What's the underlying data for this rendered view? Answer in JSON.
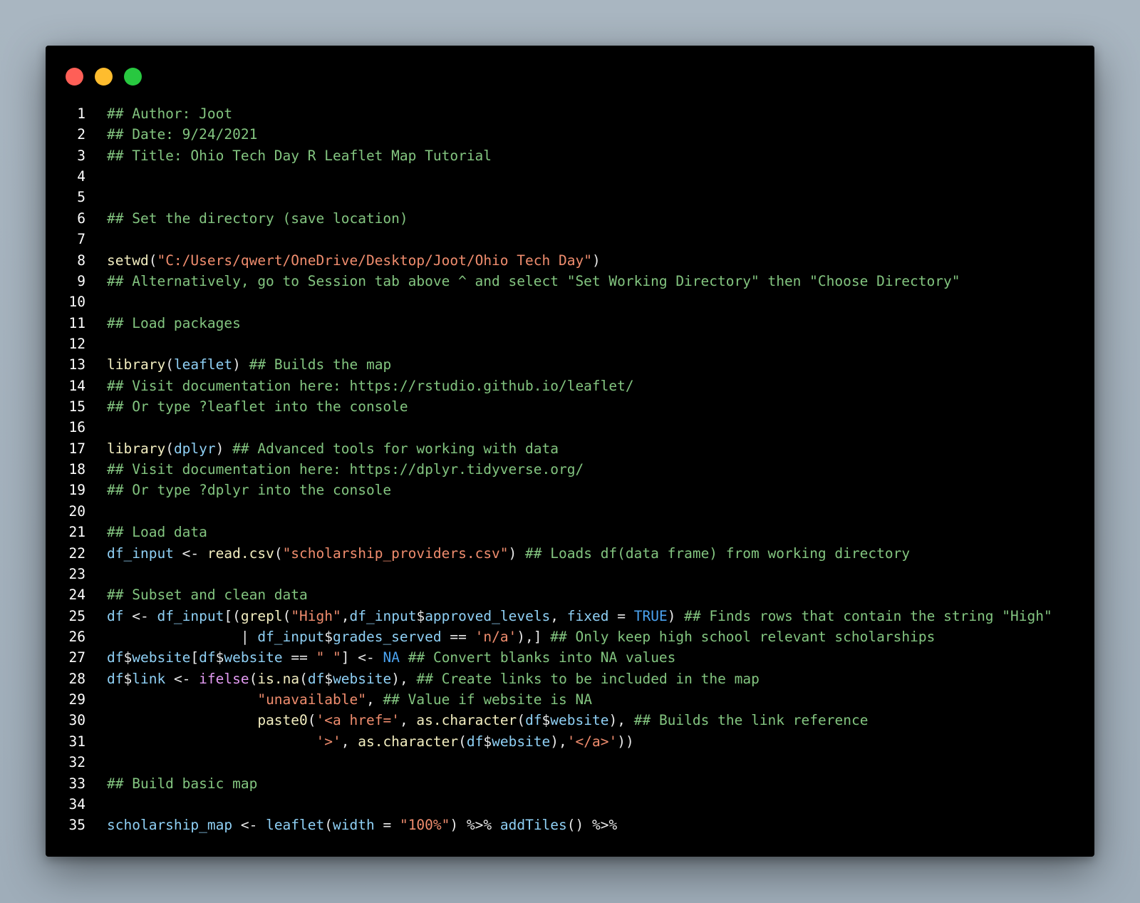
{
  "window": {
    "controls": [
      {
        "name": "close",
        "color": "#fe5f57"
      },
      {
        "name": "minimize",
        "color": "#febc2e"
      },
      {
        "name": "maximize",
        "color": "#28c840"
      }
    ]
  },
  "colors": {
    "comment": "#8fd68b",
    "string": "#f08d6e",
    "identifier": "#8fd0f5",
    "function": "#f3eec0",
    "constant": "#4ba3f0",
    "ifelse": "#e39bf2",
    "plain": "#e8e8e8"
  },
  "lines": [
    {
      "n": "1",
      "tokens": [
        [
          "cm",
          "## Author: Joot"
        ]
      ]
    },
    {
      "n": "2",
      "tokens": [
        [
          "cm",
          "## Date: 9/24/2021"
        ]
      ]
    },
    {
      "n": "3",
      "tokens": [
        [
          "cm",
          "## Title: Ohio Tech Day R Leaflet Map Tutorial"
        ]
      ]
    },
    {
      "n": "4",
      "tokens": []
    },
    {
      "n": "5",
      "tokens": []
    },
    {
      "n": "6",
      "tokens": [
        [
          "cm",
          "## Set the directory (save location)"
        ]
      ]
    },
    {
      "n": "7",
      "tokens": []
    },
    {
      "n": "8",
      "tokens": [
        [
          "fn",
          "setwd"
        ],
        [
          "plain",
          "("
        ],
        [
          "str",
          "\"C:/Users/qwert/OneDrive/Desktop/Joot/Ohio Tech Day\""
        ],
        [
          "plain",
          ")"
        ]
      ]
    },
    {
      "n": "9",
      "tokens": [
        [
          "cm",
          "## Alternatively, go to Session tab above ^ and select \"Set Working Directory\" then \"Choose Directory\""
        ]
      ]
    },
    {
      "n": "10",
      "tokens": []
    },
    {
      "n": "11",
      "tokens": [
        [
          "cm",
          "## Load packages"
        ]
      ]
    },
    {
      "n": "12",
      "tokens": []
    },
    {
      "n": "13",
      "tokens": [
        [
          "fn",
          "library"
        ],
        [
          "plain",
          "("
        ],
        [
          "id",
          "leaflet"
        ],
        [
          "plain",
          ") "
        ],
        [
          "cm",
          "## Builds the map"
        ]
      ]
    },
    {
      "n": "14",
      "tokens": [
        [
          "cm",
          "## Visit documentation here: https://rstudio.github.io/leaflet/"
        ]
      ]
    },
    {
      "n": "15",
      "tokens": [
        [
          "cm",
          "## Or type ?leaflet into the console"
        ]
      ]
    },
    {
      "n": "16",
      "tokens": []
    },
    {
      "n": "17",
      "tokens": [
        [
          "fn",
          "library"
        ],
        [
          "plain",
          "("
        ],
        [
          "id",
          "dplyr"
        ],
        [
          "plain",
          ") "
        ],
        [
          "cm",
          "## Advanced tools for working with data"
        ]
      ]
    },
    {
      "n": "18",
      "tokens": [
        [
          "cm",
          "## Visit documentation here: https://dplyr.tidyverse.org/"
        ]
      ]
    },
    {
      "n": "19",
      "tokens": [
        [
          "cm",
          "## Or type ?dplyr into the console"
        ]
      ]
    },
    {
      "n": "20",
      "tokens": []
    },
    {
      "n": "21",
      "tokens": [
        [
          "cm",
          "## Load data"
        ]
      ]
    },
    {
      "n": "22",
      "tokens": [
        [
          "id",
          "df_input"
        ],
        [
          "plain",
          " <- "
        ],
        [
          "fn",
          "read.csv"
        ],
        [
          "plain",
          "("
        ],
        [
          "str",
          "\"scholarship_providers.csv\""
        ],
        [
          "plain",
          ") "
        ],
        [
          "cm",
          "## Loads df(data frame) from working directory"
        ]
      ]
    },
    {
      "n": "23",
      "tokens": []
    },
    {
      "n": "24",
      "tokens": [
        [
          "cm",
          "## Subset and clean data"
        ]
      ]
    },
    {
      "n": "25",
      "tokens": [
        [
          "id",
          "df"
        ],
        [
          "plain",
          " <- "
        ],
        [
          "id",
          "df_input"
        ],
        [
          "plain",
          "[("
        ],
        [
          "fn",
          "grepl"
        ],
        [
          "plain",
          "("
        ],
        [
          "str",
          "\"High\""
        ],
        [
          "plain",
          ","
        ],
        [
          "id",
          "df_input"
        ],
        [
          "plain",
          "$"
        ],
        [
          "id",
          "approved_levels"
        ],
        [
          "plain",
          ", "
        ],
        [
          "id",
          "fixed"
        ],
        [
          "plain",
          " = "
        ],
        [
          "kw",
          "TRUE"
        ],
        [
          "plain",
          ") "
        ],
        [
          "cm",
          "## Finds rows that contain the string \"High\""
        ]
      ]
    },
    {
      "n": "26",
      "tokens": [
        [
          "plain",
          "                | "
        ],
        [
          "id",
          "df_input"
        ],
        [
          "plain",
          "$"
        ],
        [
          "id",
          "grades_served"
        ],
        [
          "plain",
          " == "
        ],
        [
          "str",
          "'n/a'"
        ],
        [
          "plain",
          "),] "
        ],
        [
          "cm",
          "## Only keep high school relevant scholarships"
        ]
      ]
    },
    {
      "n": "27",
      "tokens": [
        [
          "id",
          "df"
        ],
        [
          "plain",
          "$"
        ],
        [
          "id",
          "website"
        ],
        [
          "plain",
          "["
        ],
        [
          "id",
          "df"
        ],
        [
          "plain",
          "$"
        ],
        [
          "id",
          "website"
        ],
        [
          "plain",
          " == "
        ],
        [
          "str",
          "\" \""
        ],
        [
          "plain",
          "] <- "
        ],
        [
          "kw",
          "NA"
        ],
        [
          "plain",
          " "
        ],
        [
          "cm",
          "## Convert blanks into NA values"
        ]
      ]
    },
    {
      "n": "28",
      "tokens": [
        [
          "id",
          "df"
        ],
        [
          "plain",
          "$"
        ],
        [
          "id",
          "link"
        ],
        [
          "plain",
          " <- "
        ],
        [
          "kw2",
          "ifelse"
        ],
        [
          "plain",
          "("
        ],
        [
          "fn",
          "is.na"
        ],
        [
          "plain",
          "("
        ],
        [
          "id",
          "df"
        ],
        [
          "plain",
          "$"
        ],
        [
          "id",
          "website"
        ],
        [
          "plain",
          "), "
        ],
        [
          "cm",
          "## Create links to be included in the map"
        ]
      ]
    },
    {
      "n": "29",
      "tokens": [
        [
          "plain",
          "                  "
        ],
        [
          "str",
          "\"unavailable\""
        ],
        [
          "plain",
          ", "
        ],
        [
          "cm",
          "## Value if website is NA"
        ]
      ]
    },
    {
      "n": "30",
      "tokens": [
        [
          "plain",
          "                  "
        ],
        [
          "fn",
          "paste0"
        ],
        [
          "plain",
          "("
        ],
        [
          "str",
          "'<a href='"
        ],
        [
          "plain",
          ", "
        ],
        [
          "fn",
          "as.character"
        ],
        [
          "plain",
          "("
        ],
        [
          "id",
          "df"
        ],
        [
          "plain",
          "$"
        ],
        [
          "id",
          "website"
        ],
        [
          "plain",
          "), "
        ],
        [
          "cm",
          "## Builds the link reference"
        ]
      ]
    },
    {
      "n": "31",
      "tokens": [
        [
          "plain",
          "                         "
        ],
        [
          "str",
          "'>'"
        ],
        [
          "plain",
          ", "
        ],
        [
          "fn",
          "as.character"
        ],
        [
          "plain",
          "("
        ],
        [
          "id",
          "df"
        ],
        [
          "plain",
          "$"
        ],
        [
          "id",
          "website"
        ],
        [
          "plain",
          "),"
        ],
        [
          "str",
          "'</a>'"
        ],
        [
          "plain",
          "))"
        ]
      ]
    },
    {
      "n": "32",
      "tokens": []
    },
    {
      "n": "33",
      "tokens": [
        [
          "cm",
          "## Build basic map"
        ]
      ]
    },
    {
      "n": "34",
      "tokens": []
    },
    {
      "n": "35",
      "tokens": [
        [
          "id",
          "scholarship_map"
        ],
        [
          "plain",
          " <- "
        ],
        [
          "id",
          "leaflet"
        ],
        [
          "plain",
          "("
        ],
        [
          "id",
          "width"
        ],
        [
          "plain",
          " = "
        ],
        [
          "str",
          "\"100%\""
        ],
        [
          "plain",
          ") %>% "
        ],
        [
          "id",
          "addTiles"
        ],
        [
          "plain",
          "() %>%"
        ]
      ]
    }
  ]
}
